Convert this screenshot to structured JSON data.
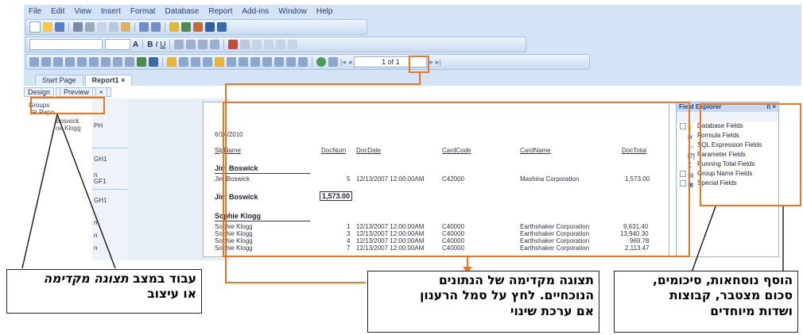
{
  "menu": [
    "File",
    "Edit",
    "View",
    "Insert",
    "Format",
    "Database",
    "Report",
    "Add-ins",
    "Window",
    "Help"
  ],
  "toolbar": {
    "page_indicator": "1 of 1",
    "font_size": "A"
  },
  "doc_tabs": [
    "Start Page",
    "Report1"
  ],
  "doc_tab_close": "×",
  "sub_tabs": [
    "Design",
    "Preview"
  ],
  "tree": {
    "root": "Groups",
    "child": "Repo",
    "items": [
      "Boswick",
      "oe Klogg"
    ]
  },
  "sections": [
    "PH",
    "GH1",
    "n",
    "GF1",
    "GH1",
    "n",
    "n",
    "n"
  ],
  "report": {
    "date": "6/14/2010",
    "headers": [
      "SlpName",
      "DocNum",
      "DocDate",
      "CardCode",
      "CardName",
      "DocTotal"
    ],
    "group1": {
      "name": "Jim Boswick",
      "rows": [
        {
          "slp": "Jim Boswick",
          "num": "5",
          "date": "12/13/2007  12:00:00AM",
          "code": "C42000",
          "cname": "Mashina Corporation",
          "total": "1,573.00"
        }
      ],
      "footer_name": "Jim Boswick",
      "footer_total": "1,573.00"
    },
    "group2": {
      "name": "Sophie Klogg",
      "rows": [
        {
          "slp": "Sophie Klogg",
          "num": "1",
          "date": "12/13/2007  12:00:00AM",
          "code": "C40000",
          "cname": "Earthshaker Corporation",
          "total": "9,631.40"
        },
        {
          "slp": "Sophie Klogg",
          "num": "3",
          "date": "12/13/2007  12:00:00AM",
          "code": "C40000",
          "cname": "Earthshaker Corporation",
          "total": "13,940.30"
        },
        {
          "slp": "Sophie Klogg",
          "num": "4",
          "date": "12/13/2007  12:00:00AM",
          "code": "C40000",
          "cname": "Earthshaker Corporation",
          "total": "969.78"
        },
        {
          "slp": "Sophie Klogg",
          "num": "7",
          "date": "12/13/2007  12:00:00AM",
          "code": "C40000",
          "cname": "Earthshaker Corporation",
          "total": "2,113.47"
        }
      ]
    }
  },
  "field_explorer": {
    "title": "Field Explorer",
    "title_buttons": "ᴨ ×",
    "items": [
      "Database Fields",
      "Formula Fields",
      "SQL Expression Fields",
      "Parameter Fields",
      "Running Total Fields",
      "Group Name Fields",
      "Special Fields"
    ],
    "item_glyphs": [
      "▮",
      "fx",
      "▭",
      "[?]",
      "Σ",
      "▤",
      "▣"
    ]
  },
  "callouts": {
    "left": {
      "a": "עבוד במצב ",
      "b": "תצוגה מקדימה",
      "c": "או עיצוב"
    },
    "middle": {
      "a": "תצוגה מקדימה של הנתונים",
      "b": "הנוכחיים. לחץ על סמל הרענון",
      "c": "אם ערכת שינוי"
    },
    "right": {
      "a": "הוסף נוסחאות, סיכומים,",
      "b": "סכום מצטבר, קבוצות",
      "c": "ושדות מיוחדים"
    }
  },
  "colors": {
    "highlight": "#e87722",
    "app_bg": "#d4e3f5",
    "toolbar_border": "#a9c1e2"
  }
}
